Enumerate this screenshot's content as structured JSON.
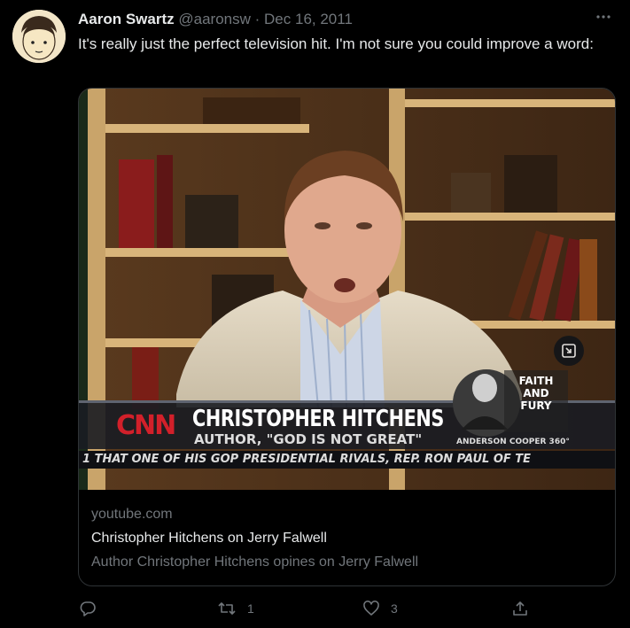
{
  "author": {
    "name": "Aaron Swartz",
    "handle": "@aaronsw",
    "separator": "·",
    "date": "Dec 16, 2011"
  },
  "more_icon": "more-horizontal-icon",
  "tweet_text": "It's really just the perfect television hit. I'm not sure you could improve a word:",
  "video": {
    "network": "CNN",
    "lower_third_name": "CHRISTOPHER HITCHENS",
    "lower_third_sub": "AUTHOR, \"GOD IS NOT GREAT\"",
    "ticker": "1 THAT ONE OF HIS GOP PRESIDENTIAL RIVALS, REP. RON PAUL OF TE",
    "segment": [
      "FAITH",
      "AND",
      "FURY"
    ],
    "show": "ANDERSON COOPER 360°"
  },
  "card": {
    "domain": "youtube.com",
    "title": "Christopher Hitchens on Jerry Falwell",
    "description": "Author Christopher Hitchens opines on Jerry Falwell"
  },
  "actions": {
    "reply_count": "",
    "retweet_count": "1",
    "like_count": "3"
  },
  "colors": {
    "background": "#000000",
    "text": "#e7e9ea",
    "muted": "#71767b",
    "border": "#2f3336",
    "cnn_red": "#d2202a"
  }
}
